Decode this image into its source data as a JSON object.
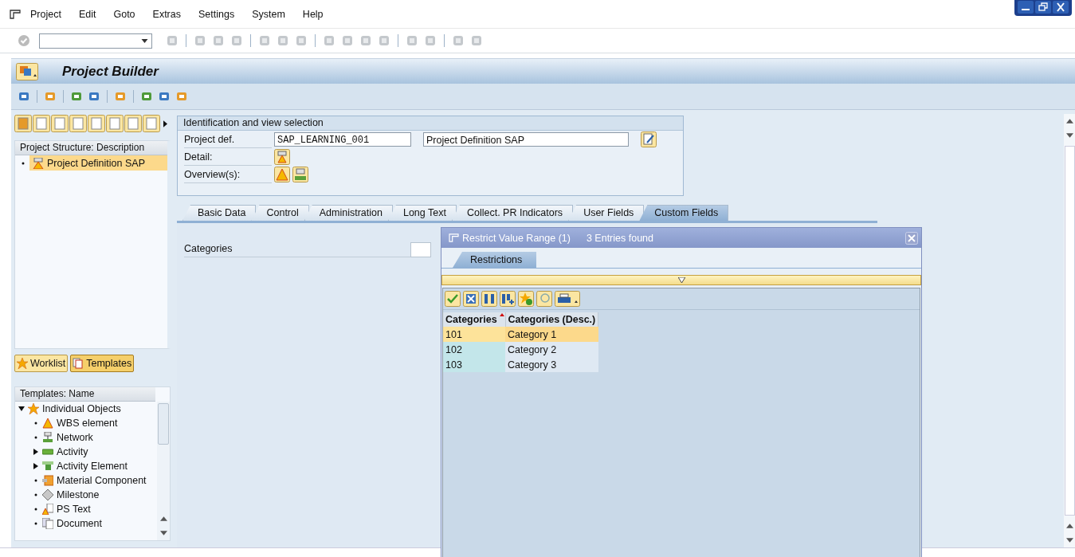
{
  "menu": [
    {
      "label": "Project"
    },
    {
      "label": "Edit"
    },
    {
      "label": "Goto"
    },
    {
      "label": "Extras"
    },
    {
      "label": "Settings"
    },
    {
      "label": "System"
    },
    {
      "label": "Help"
    }
  ],
  "title": "Project Builder",
  "structure_panel": {
    "header": "Project Structure: Description",
    "items": [
      {
        "label": "Project Definition SAP",
        "selected": true
      }
    ]
  },
  "panel_buttons": [
    {
      "label": "Worklist",
      "selected": false
    },
    {
      "label": "Templates",
      "selected": true
    }
  ],
  "templates": {
    "header": "Templates: Name",
    "tree": [
      {
        "label": "Individual Objects",
        "expanded": true,
        "children": [
          {
            "label": "WBS element",
            "expandable": false
          },
          {
            "label": "Network",
            "expandable": false
          },
          {
            "label": "Activity",
            "expandable": true
          },
          {
            "label": "Activity Element",
            "expandable": true
          },
          {
            "label": "Material Component",
            "expandable": false
          },
          {
            "label": "Milestone",
            "expandable": false
          },
          {
            "label": "PS Text",
            "expandable": false
          },
          {
            "label": "Document",
            "expandable": false
          }
        ]
      }
    ]
  },
  "identification": {
    "title": "Identification and view selection",
    "project_label": "Project def.",
    "project_value": "SAP_LEARNING_001",
    "project_description": "Project Definition SAP",
    "detail_label": "Detail:",
    "overview_label": "Overview(s):"
  },
  "tabs": [
    {
      "label": "Basic Data",
      "selected": false
    },
    {
      "label": "Control",
      "selected": false
    },
    {
      "label": "Administration",
      "selected": false
    },
    {
      "label": "Long Text",
      "selected": false
    },
    {
      "label": "Collect. PR Indicators",
      "selected": false
    },
    {
      "label": "User Fields",
      "selected": false
    },
    {
      "label": "Custom Fields",
      "selected": true
    }
  ],
  "custom_fields": [
    {
      "label": "Categories"
    }
  ],
  "dialog": {
    "title": "Restrict Value Range (1)",
    "count": "3 Entries found",
    "tabs": [
      {
        "label": "Restrictions",
        "selected": true
      }
    ],
    "columns": [
      {
        "label": "Categories",
        "sorted": true
      },
      {
        "label": "Categories (Desc.)",
        "sorted": false
      }
    ],
    "rows": [
      {
        "cells": [
          "101",
          "Category 1"
        ],
        "selected": true
      },
      {
        "cells": [
          "102",
          "Category 2"
        ],
        "selected": false
      },
      {
        "cells": [
          "103",
          "Category 3"
        ],
        "selected": false
      }
    ]
  }
}
